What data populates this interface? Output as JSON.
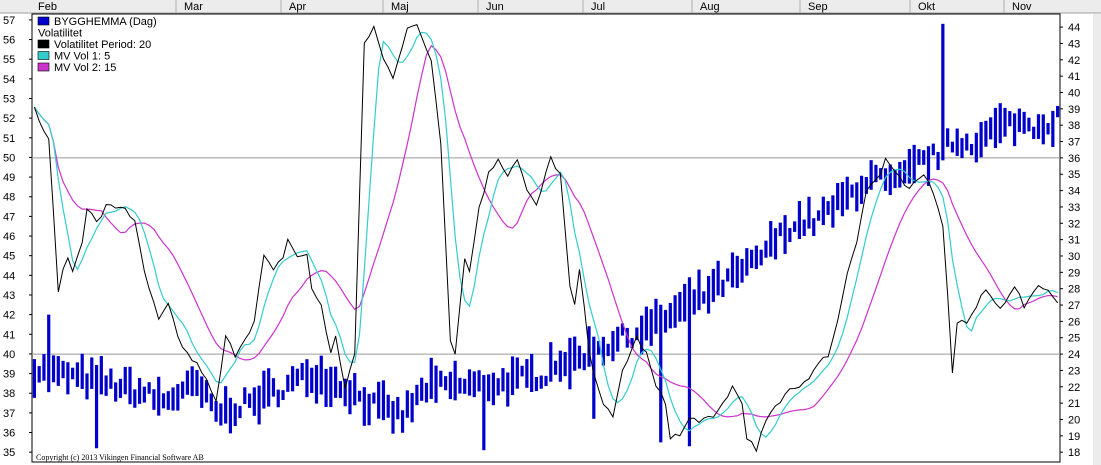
{
  "chart_data": {
    "type": "bar+line",
    "months": [
      "Feb",
      "Mar",
      "Apr",
      "Maj",
      "Jun",
      "Jul",
      "Aug",
      "Sep",
      "Okt",
      "Nov"
    ],
    "left_axis": {
      "ticks": [
        35,
        36,
        37,
        38,
        39,
        40,
        41,
        42,
        43,
        44,
        45,
        46,
        47,
        48,
        49,
        50,
        51,
        52,
        53,
        54,
        55,
        56,
        57
      ],
      "ylim": [
        34.5,
        57.3
      ]
    },
    "right_axis": {
      "ticks": [
        18,
        19,
        20,
        21,
        22,
        23,
        24,
        25,
        26,
        27,
        28,
        29,
        30,
        31,
        32,
        33,
        34,
        35,
        36,
        37,
        38,
        39,
        40,
        41,
        42,
        43,
        44
      ],
      "ylim": [
        17.4,
        44.8
      ]
    },
    "legend": [
      {
        "label": "BYGGHEMMA (Dag)",
        "color": "#0000cc"
      },
      {
        "label": "Volatilitet",
        "color": ""
      },
      {
        "label": "Volatilitet Period: 20",
        "color": "#000000"
      },
      {
        "label": "MV Vol 1: 5",
        "color": "#33cccc"
      },
      {
        "label": "MV Vol 2: 15",
        "color": "#cc33cc"
      }
    ],
    "hlines_right": [
      24,
      36
    ],
    "copyright": "Copyright (c) 2013 Vikingen Financial Software AB",
    "price_series": {
      "name": "BYGGHEMMA (Dag)",
      "color": "#0000cc",
      "start": 39.2,
      "end": 52.0,
      "anchors": [
        [
          0,
          39.2
        ],
        [
          15,
          38.5
        ],
        [
          23,
          38.0
        ],
        [
          27,
          37.6
        ],
        [
          34,
          38.4
        ],
        [
          38,
          37.0
        ],
        [
          45,
          37.5
        ],
        [
          53,
          38.4
        ],
        [
          58,
          39.0
        ],
        [
          66,
          38.2
        ],
        [
          70,
          37.5
        ],
        [
          77,
          36.8
        ],
        [
          82,
          38.3
        ],
        [
          87,
          38.4
        ],
        [
          93,
          38.4
        ],
        [
          100,
          38.6
        ],
        [
          107,
          39.0
        ],
        [
          108,
          39.5
        ],
        [
          115,
          40.0
        ],
        [
          120,
          40.5
        ],
        [
          130,
          41.5
        ],
        [
          140,
          43.0
        ],
        [
          150,
          44.5
        ],
        [
          158,
          46.5
        ],
        [
          165,
          47.0
        ],
        [
          169,
          47.8
        ],
        [
          175,
          49.0
        ],
        [
          180,
          48.5
        ],
        [
          185,
          49.7
        ],
        [
          188,
          50.0
        ],
        [
          192,
          50.8
        ],
        [
          196,
          50.8
        ],
        [
          199,
          51.0
        ],
        [
          200,
          51.3
        ],
        [
          205,
          51.8
        ],
        [
          210,
          51.6
        ],
        [
          214,
          52.0
        ]
      ],
      "spikes": [
        [
          190,
          56.8
        ],
        [
          180,
          49.4
        ],
        [
          200,
          51.8
        ],
        [
          205,
          51.0
        ],
        [
          210,
          52.2
        ],
        [
          3,
          42.0
        ],
        [
          13,
          35.2
        ],
        [
          94,
          35.1
        ],
        [
          137,
          35.3
        ],
        [
          112,
          38.2
        ],
        [
          117,
          36.7
        ],
        [
          131,
          35.5
        ],
        [
          153,
          45.5
        ],
        [
          163,
          46.0
        ],
        [
          170,
          48.7
        ]
      ]
    },
    "volatility": {
      "name": "Volatilitet Period: 20",
      "color": "#000000",
      "points": [
        [
          0,
          39
        ],
        [
          3,
          37
        ],
        [
          5,
          28
        ],
        [
          7,
          30
        ],
        [
          8,
          29
        ],
        [
          10,
          31
        ],
        [
          11,
          33
        ],
        [
          13,
          32
        ],
        [
          15,
          33
        ],
        [
          17,
          33
        ],
        [
          19,
          33
        ],
        [
          21,
          32
        ],
        [
          23,
          29
        ],
        [
          25,
          27
        ],
        [
          26,
          26
        ],
        [
          28,
          27
        ],
        [
          30,
          25
        ],
        [
          32,
          24
        ],
        [
          35,
          23
        ],
        [
          38,
          21
        ],
        [
          40,
          25
        ],
        [
          42,
          24
        ],
        [
          44,
          25
        ],
        [
          46,
          26
        ],
        [
          48,
          30
        ],
        [
          50,
          29
        ],
        [
          52,
          30
        ],
        [
          53,
          31
        ],
        [
          55,
          30
        ],
        [
          57,
          30
        ],
        [
          58,
          28
        ],
        [
          60,
          27
        ],
        [
          62,
          24
        ],
        [
          63,
          25
        ],
        [
          65,
          22
        ],
        [
          67,
          24
        ],
        [
          69,
          43
        ],
        [
          71,
          44
        ],
        [
          73,
          42
        ],
        [
          75,
          41
        ],
        [
          77,
          43
        ],
        [
          78,
          44
        ],
        [
          80,
          44
        ],
        [
          83,
          42
        ],
        [
          85,
          37
        ],
        [
          87,
          25
        ],
        [
          88,
          24
        ],
        [
          90,
          30
        ],
        [
          91,
          29
        ],
        [
          93,
          33
        ],
        [
          95,
          35
        ],
        [
          97,
          36
        ],
        [
          99,
          35
        ],
        [
          101,
          36
        ],
        [
          103,
          34
        ],
        [
          105,
          33
        ],
        [
          108,
          36
        ],
        [
          110,
          35
        ],
        [
          112,
          28
        ],
        [
          113,
          27
        ],
        [
          114,
          29
        ],
        [
          115,
          27
        ],
        [
          116,
          24
        ],
        [
          118,
          22
        ],
        [
          119,
          21
        ],
        [
          121,
          20
        ],
        [
          123,
          23
        ],
        [
          126,
          25
        ],
        [
          128,
          24
        ],
        [
          130,
          22
        ],
        [
          132,
          21
        ],
        [
          133,
          19
        ],
        [
          135,
          19
        ],
        [
          137,
          20
        ],
        [
          140,
          20
        ],
        [
          142,
          20
        ],
        [
          144,
          21
        ],
        [
          146,
          22
        ],
        [
          148,
          21
        ],
        [
          149,
          19
        ],
        [
          151,
          18
        ],
        [
          153,
          20
        ],
        [
          156,
          21
        ],
        [
          158,
          22
        ],
        [
          160,
          22
        ],
        [
          163,
          23
        ],
        [
          166,
          24
        ],
        [
          168,
          26
        ],
        [
          170,
          29
        ],
        [
          172,
          31
        ],
        [
          174,
          34
        ],
        [
          177,
          35
        ],
        [
          178,
          36
        ],
        [
          180,
          35
        ],
        [
          183,
          34
        ],
        [
          186,
          35
        ],
        [
          188,
          34
        ],
        [
          190,
          32
        ],
        [
          192,
          23
        ],
        [
          193,
          26
        ],
        [
          195,
          26
        ],
        [
          197,
          27
        ],
        [
          199,
          28
        ],
        [
          201,
          27
        ],
        [
          203,
          27
        ],
        [
          205,
          28
        ],
        [
          207,
          27
        ],
        [
          209,
          28
        ],
        [
          212,
          28
        ],
        [
          214,
          27
        ]
      ]
    },
    "mv_vol_1": {
      "name": "MV Vol 1: 5",
      "color": "#33cccc",
      "period": 5
    },
    "mv_vol_2": {
      "name": "MV Vol 2: 15",
      "color": "#cc33cc",
      "period": 15
    }
  }
}
